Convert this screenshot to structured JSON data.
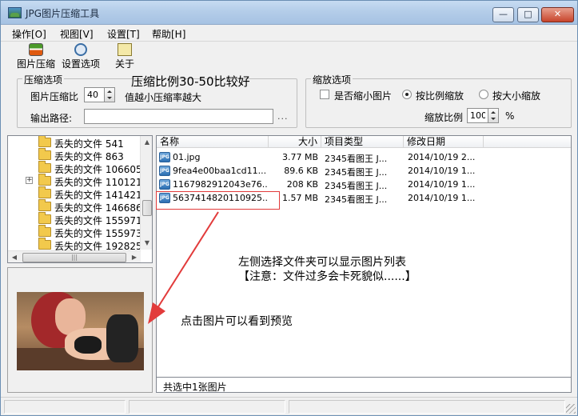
{
  "window": {
    "title": "JPG图片压缩工具",
    "min_glyph": "—",
    "max_glyph": "□",
    "close_glyph": "✕"
  },
  "menu": [
    "操作[O]",
    "视图[V]",
    "设置[T]",
    "帮助[H]"
  ],
  "toolbar": {
    "compress_label": "图片压缩",
    "settings_label": "设置选项",
    "about_label": "关于"
  },
  "compress_options": {
    "group_title": "压缩选项",
    "hint_big": "压缩比例30-50比较好",
    "ratio_label": "图片压缩比",
    "ratio_value": "40",
    "ratio_hint": "值越小压缩率越大",
    "output_label": "输出路径:",
    "output_value": "",
    "browse_label": "..."
  },
  "scale_options": {
    "group_title": "缩放选项",
    "checkbox_label": "是否缩小图片",
    "checkbox_checked": false,
    "radio_ratio_label": "按比例缩放",
    "radio_size_label": "按大小缩放",
    "selected_radio": "ratio",
    "scale_label": "缩放比例",
    "scale_value": "100",
    "scale_unit": "%"
  },
  "tree": {
    "items": [
      {
        "name": "丢失的文件",
        "id": "541",
        "expandable": false
      },
      {
        "name": "丢失的文件",
        "id": "863",
        "expandable": false
      },
      {
        "name": "丢失的文件",
        "id": "106605",
        "expandable": false
      },
      {
        "name": "丢失的文件",
        "id": "110121",
        "expandable": true
      },
      {
        "name": "丢失的文件",
        "id": "141421",
        "expandable": false
      },
      {
        "name": "丢失的文件",
        "id": "146686",
        "expandable": false
      },
      {
        "name": "丢失的文件",
        "id": "155971",
        "expandable": false
      },
      {
        "name": "丢失的文件",
        "id": "155973",
        "expandable": false
      },
      {
        "name": "丢失的文件",
        "id": "192825",
        "expandable": false
      }
    ]
  },
  "file_list": {
    "columns": [
      "名称",
      "大小",
      "项目类型",
      "修改日期"
    ],
    "icon_text": "JPG",
    "rows": [
      {
        "name": "01.jpg",
        "size": "3.77 MB",
        "type": "2345看图王 J...",
        "modified": "2014/10/19 2..."
      },
      {
        "name": "9fea4e00baa1cd11...",
        "size": "89.6 KB",
        "type": "2345看图王 J...",
        "modified": "2014/10/19 1..."
      },
      {
        "name": "1167982912043e76...",
        "size": "208 KB",
        "type": "2345看图王 J...",
        "modified": "2014/10/19 1..."
      },
      {
        "name": "5637414820110925...",
        "size": "1.57 MB",
        "type": "2345看图王 J...",
        "modified": "2014/10/19 1..."
      }
    ],
    "selected_index": 3,
    "status": "共选中1张图片"
  },
  "annotations": {
    "list_note_line1": "左侧选择文件夹可以显示图片列表",
    "list_note_line2": "【注意：文件过多会卡死貌似......】",
    "preview_note": "点击图片可以看到预览"
  },
  "colors": {
    "annotation_red": "#e23b3b",
    "titlebar": "#b4cde9"
  }
}
